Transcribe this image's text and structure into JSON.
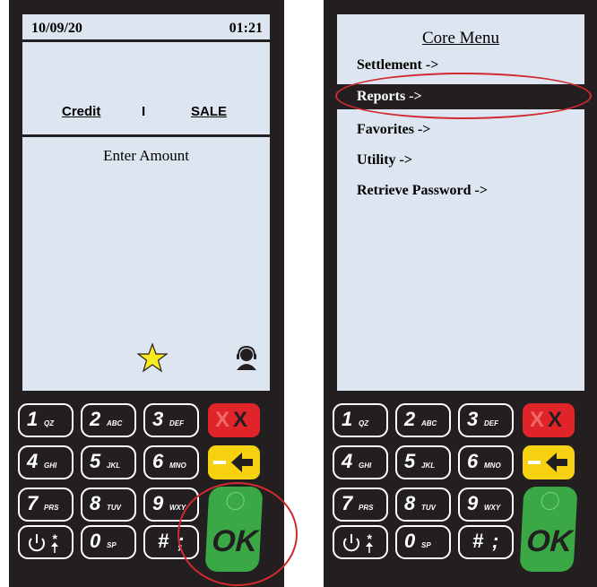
{
  "left_terminal": {
    "date": "10/09/20",
    "time": "01:21",
    "card_type": "Credit",
    "separator": "I",
    "transaction": "SALE",
    "prompt": "Enter Amount",
    "shortcut_icons": [
      "star-icon",
      "support-agent-icon"
    ]
  },
  "right_terminal": {
    "menu_title": "Core Menu",
    "menu_items": [
      "Settlement ->",
      "Reports ->",
      "Favorites ->",
      "Utility ->",
      "Retrieve Password ->"
    ],
    "selected_item": "Reports ->"
  },
  "keypad": {
    "digits": [
      {
        "num": "1",
        "letters": "QZ"
      },
      {
        "num": "2",
        "letters": "ABC"
      },
      {
        "num": "3",
        "letters": "DEF"
      },
      {
        "num": "4",
        "letters": "GHI"
      },
      {
        "num": "5",
        "letters": "JKL"
      },
      {
        "num": "6",
        "letters": "MNO"
      },
      {
        "num": "7",
        "letters": "PRS"
      },
      {
        "num": "8",
        "letters": "TUV"
      },
      {
        "num": "9",
        "letters": "WXY"
      },
      {
        "num": "0",
        "letters": "SP"
      }
    ],
    "hash_label": "#",
    "hash_sub": ";",
    "cancel_label": "X",
    "ok_label": "OK"
  },
  "colors": {
    "screen": "#dde6f0",
    "body": "#231f20",
    "cancel": "#e0242a",
    "clear": "#f6d110",
    "ok": "#3aa845",
    "callout": "#cf2a30",
    "star": "#f8ea1c"
  },
  "callouts": [
    "Reports menu item",
    "OK key"
  ]
}
